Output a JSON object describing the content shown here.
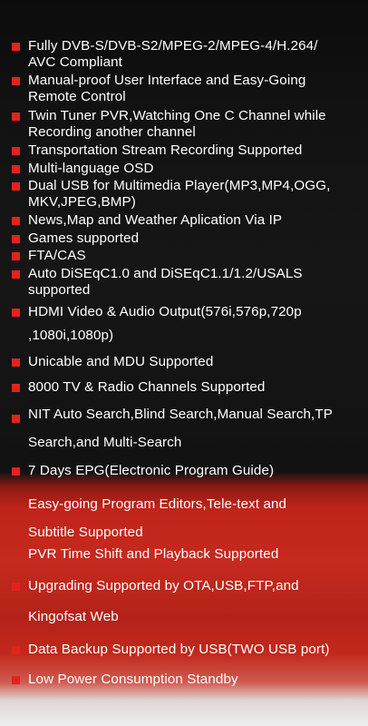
{
  "features": [
    {
      "lines": [
        "Fully DVB-S/DVB-S2/MPEG-2/MPEG-4/H.264/",
        "AVC Compliant"
      ]
    },
    {
      "lines": [
        "Manual-proof User Interface and Easy-Going",
        "Remote Control"
      ]
    },
    {
      "lines": [
        "Twin Tuner PVR,Watching One C Channel while",
        "Recording another channel"
      ]
    },
    {
      "lines": [
        "Transportation Stream Recording Supported"
      ]
    },
    {
      "lines": [
        "Multi-language OSD"
      ]
    },
    {
      "lines": [
        "Dual USB for Multimedia Player(MP3,MP4,OGG,",
        "MKV,JPEG,BMP)"
      ]
    },
    {
      "lines": [
        "News,Map and Weather Aplication Via IP"
      ]
    },
    {
      "lines": [
        "Games supported"
      ]
    },
    {
      "lines": [
        "FTA/CAS"
      ]
    },
    {
      "lines": [
        "Auto DiSEqC1.0 and DiSEqC1.1/1.2/USALS",
        "supported"
      ]
    },
    {
      "lines": [
        "HDMI Video & Audio Output(576i,576p,720p",
        ",1080i,1080p)"
      ]
    },
    {
      "lines": [
        "Unicable and MDU Supported"
      ]
    },
    {
      "lines": [
        "8000 TV & Radio Channels Supported"
      ]
    },
    {
      "lines": [
        "NIT Auto Search,Blind Search,Manual Search,TP",
        "Search,and Multi-Search"
      ]
    },
    {
      "lines": [
        "7 Days EPG(Electronic Program Guide)"
      ]
    },
    {
      "lines": [
        "Easy-going Program Editors,Tele-text and",
        "Subtitle Supported"
      ]
    },
    {
      "lines": [
        "PVR Time Shift and Playback Supported"
      ]
    },
    {
      "lines": [
        "Upgrading Supported by OTA,USB,FTP,and",
        "Kingofsat Web"
      ]
    },
    {
      "lines": [
        "Data Backup Supported by USB(TWO USB port)"
      ]
    },
    {
      "lines": [
        "Low Power Consumption Standby"
      ]
    }
  ],
  "colors": {
    "bullet": "#e3231b",
    "text": "#ffffff",
    "background_dark": "#121212",
    "background_red": "#c62a1e"
  }
}
